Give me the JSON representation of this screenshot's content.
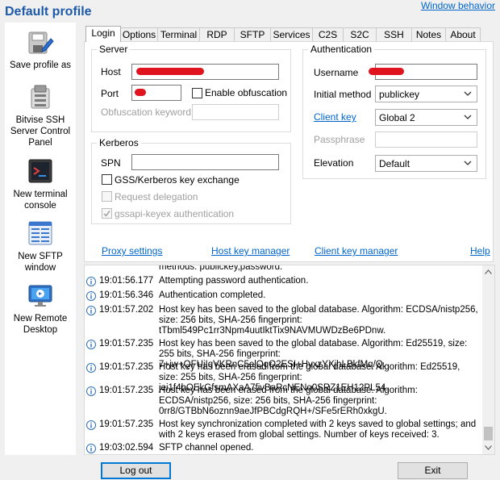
{
  "title": "Default profile",
  "window_behavior": "Window behavior",
  "sidebar": {
    "items": [
      {
        "label": "Save profile as",
        "icon": "save-profile-icon"
      },
      {
        "label": "Bitvise SSH Server Control Panel",
        "icon": "server-control-panel-icon"
      },
      {
        "label": "New terminal console",
        "icon": "terminal-console-icon"
      },
      {
        "label": "New SFTP window",
        "icon": "sftp-window-icon"
      },
      {
        "label": "New Remote Desktop",
        "icon": "remote-desktop-icon"
      }
    ]
  },
  "tabs": [
    "Login",
    "Options",
    "Terminal",
    "RDP",
    "SFTP",
    "Services",
    "C2S",
    "S2C",
    "SSH",
    "Notes",
    "About"
  ],
  "active_tab": "Login",
  "server": {
    "legend": "Server",
    "host_label": "Host",
    "port_label": "Port",
    "enable_obfuscation": "Enable obfuscation",
    "obfuscation_keyword": "Obfuscation keyword"
  },
  "kerberos": {
    "legend": "Kerberos",
    "spn_label": "SPN",
    "gss_label": "GSS/Kerberos key exchange",
    "request_delegation": "Request delegation",
    "gssapi_keyex": "gssapi-keyex authentication"
  },
  "authentication": {
    "legend": "Authentication",
    "username_label": "Username",
    "initial_method_label": "Initial method",
    "initial_method_value": "publickey",
    "client_key_label": "Client key",
    "client_key_value": "Global 2",
    "passphrase_label": "Passphrase",
    "elevation_label": "Elevation",
    "elevation_value": "Default"
  },
  "links": {
    "proxy": "Proxy settings",
    "host_key_manager": "Host key manager",
    "client_key_manager": "Client key manager",
    "help": "Help"
  },
  "log": [
    {
      "time": "",
      "msg": "methods: publickey,password."
    },
    {
      "time": "19:01:56.177",
      "msg": "Attempting password authentication."
    },
    {
      "time": "19:01:56.346",
      "msg": "Authentication completed."
    },
    {
      "time": "19:01:57.202",
      "msg": "Host key has been saved to the global database. Algorithm: ECDSA/nistp256, size: 256 bits, SHA-256 fingerprint: tTbml549Pc1rr3Npm4uutIktTix9NAVMUWDzBe6PDnw."
    },
    {
      "time": "19:01:57.235",
      "msg": "Host key has been saved to the global database. Algorithm: Ed25519, size: 255 bits, SHA-256 fingerprint: 7+jw+QFUjIqVKRnC5elQqQ2ESI+HyxzYXjhLBkfMq/Q."
    },
    {
      "time": "19:01:57.235",
      "msg": "Host key has been erased from the global database. Algorithm: Ed25519, size: 255 bits, SHA-256 fingerprint: jei1f4bOEkGfsmAXaA7fivBaRcNENo0SRZ1EH12PL54."
    },
    {
      "time": "19:01:57.235",
      "msg": "Host key has been erased from the global database. Algorithm: ECDSA/nistp256, size: 256 bits, SHA-256 fingerprint: 0rr8/GTBbN6oznn9aeJfPBCdgRQH+/SFe5rERh0xkgU."
    },
    {
      "time": "19:01:57.235",
      "msg": "Host key synchronization completed with 2 keys saved to global settings; and with 2 keys erased from global settings. Number of keys received: 3."
    },
    {
      "time": "19:03:02.594",
      "msg": "SFTP channel opened."
    }
  ],
  "buttons": {
    "logout": "Log out",
    "exit": "Exit"
  },
  "colors": {
    "title": "#1e5aa8",
    "link": "#0066cc",
    "redaction": "#e0141f"
  }
}
